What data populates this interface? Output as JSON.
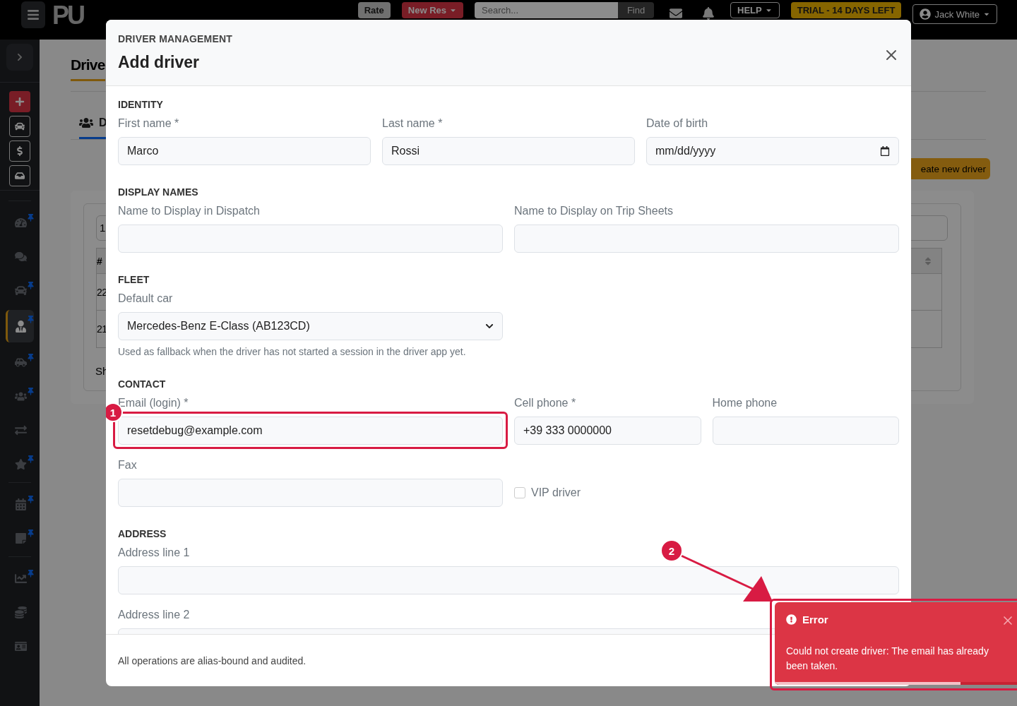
{
  "topbar": {
    "logo": "PU",
    "rate": "Rate",
    "new_res": "New Res",
    "search_placeholder": "Search...",
    "find": "Find",
    "help": "HELP",
    "trial": "TRIAL - 14 DAYS LEFT",
    "user": "Jack White"
  },
  "sidebar": {
    "quick_actions": [
      {
        "kind": "add"
      },
      {
        "kind": "car"
      },
      {
        "kind": "dollar"
      },
      {
        "kind": "inbox"
      }
    ],
    "groups": [
      [
        {
          "kind": "gauge",
          "pinned": true,
          "selected": false
        },
        {
          "kind": "chat",
          "pinned": false,
          "selected": false
        },
        {
          "kind": "car",
          "pinned": true,
          "selected": false
        },
        {
          "kind": "user",
          "pinned": true,
          "selected": true
        },
        {
          "kind": "carside",
          "pinned": true,
          "selected": false
        },
        {
          "kind": "users",
          "pinned": true,
          "selected": false
        },
        {
          "kind": "exchange",
          "pinned": false,
          "selected": false
        },
        {
          "kind": "star",
          "pinned": true,
          "selected": false
        }
      ],
      [
        {
          "kind": "calendar",
          "pinned": true,
          "selected": false
        },
        {
          "kind": "note",
          "pinned": true,
          "selected": false
        }
      ],
      [
        {
          "kind": "chart",
          "pinned": true,
          "selected": false
        },
        {
          "kind": "coins",
          "pinned": false,
          "selected": false
        },
        {
          "kind": "idcard",
          "pinned": false,
          "selected": false
        }
      ]
    ]
  },
  "page": {
    "title": "Drive",
    "tab": "D",
    "create_button": "eate new driver",
    "page_size": "1",
    "table": {
      "columns": [
        "#"
      ],
      "rows": [
        "22",
        "21"
      ]
    },
    "footer": "Sh"
  },
  "modal": {
    "eyebrow": "DRIVER MANAGEMENT",
    "title": "Add driver",
    "sections": [
      {
        "title": "IDENTITY",
        "fields": [
          {
            "kind": "text",
            "label": "First name *",
            "value": "Marco"
          },
          {
            "kind": "text",
            "label": "Last name *",
            "value": "Rossi"
          },
          {
            "kind": "date",
            "label": "Date of birth",
            "value": "mm/dd/yyyy"
          }
        ]
      },
      {
        "title": "DISPLAY NAMES",
        "fields": [
          {
            "kind": "text",
            "label": "Name to Display in Dispatch"
          },
          {
            "kind": "text",
            "label": "Name to Display on Trip Sheets"
          }
        ]
      },
      {
        "title": "FLEET",
        "fields": [
          {
            "kind": "select",
            "label": "Default car",
            "value": "Mercedes-Benz E-Class (AB123CD)",
            "help": "Used as fallback when the driver has not started a session in the driver app yet."
          }
        ]
      },
      {
        "title": "CONTACT",
        "fields": [
          {
            "kind": "text",
            "label": "Email (login) *",
            "value": "resetdebug@example.com",
            "marker": "1"
          },
          {
            "kind": "text",
            "label": "Cell phone *",
            "value": "+39 333 0000000"
          },
          {
            "kind": "text",
            "label": "Home phone"
          },
          {
            "kind": "text",
            "label": "Fax"
          },
          {
            "kind": "checkbox",
            "label": "VIP driver",
            "checked": false
          }
        ]
      },
      {
        "title": "ADDRESS",
        "fields": [
          {
            "kind": "text",
            "label": "Address line 1"
          },
          {
            "kind": "text",
            "label": "Address line 2"
          }
        ]
      }
    ],
    "footer": "All operations are alias-bound and audited."
  },
  "toast": {
    "title": "Error",
    "message": "Could not create driver: The email has already been taken.",
    "level": 0.75,
    "marker": "2"
  }
}
